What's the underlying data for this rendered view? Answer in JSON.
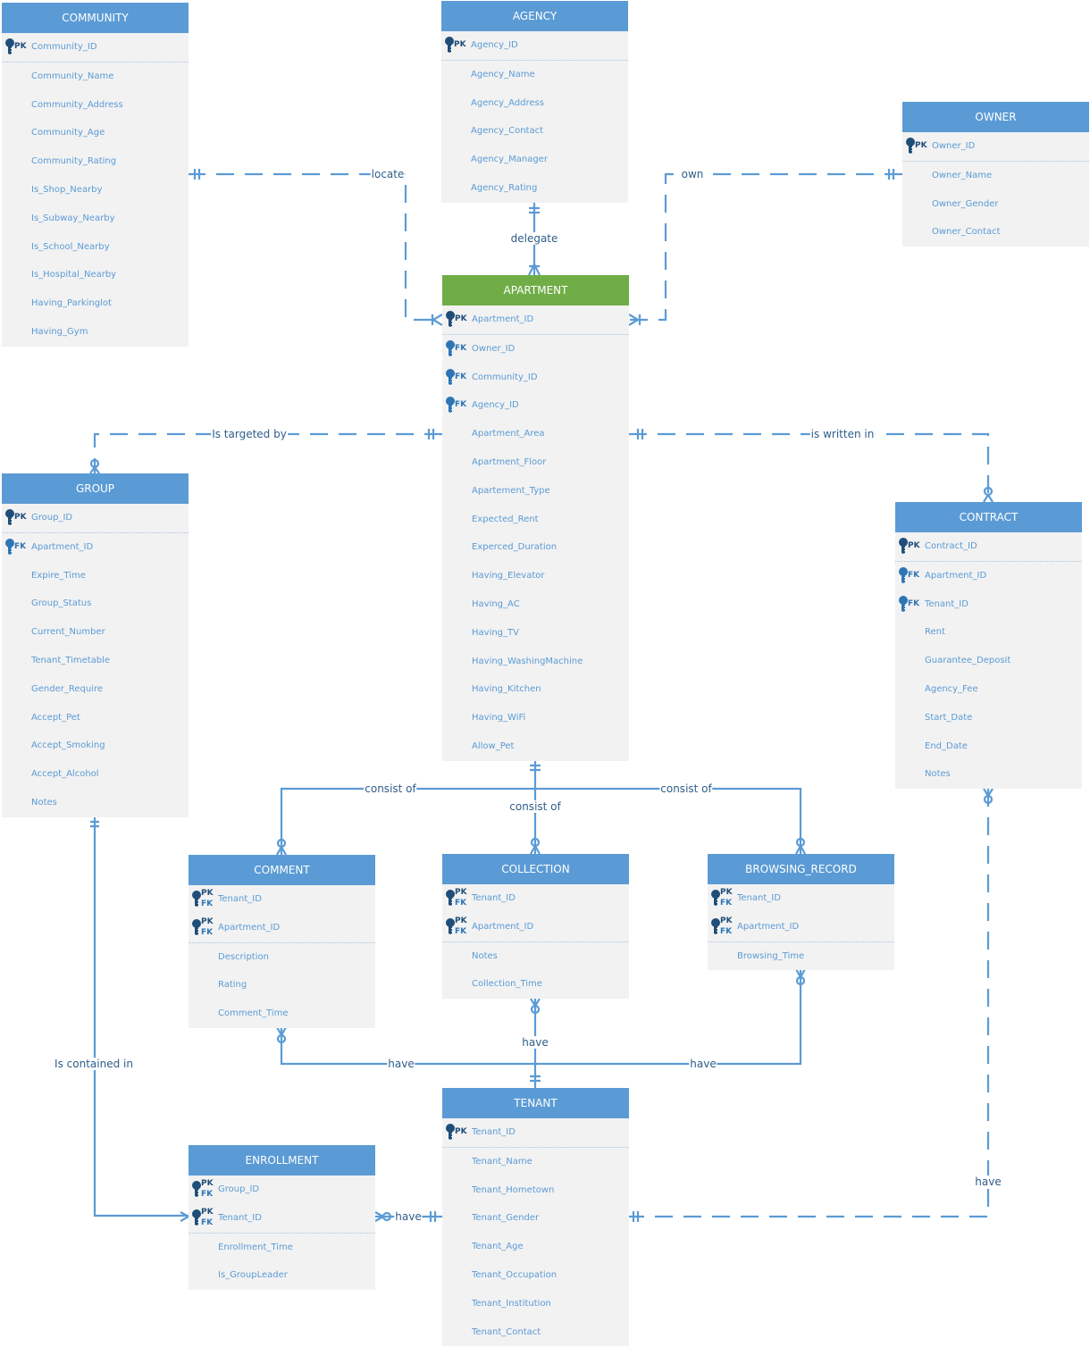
{
  "colors": {
    "header": "#5b9bd5",
    "header_main": "#70ad47",
    "line": "#5b9bd5",
    "key_pk": "#1f4e79",
    "key_fk": "#2e75b6"
  },
  "entities": [
    {
      "id": "community",
      "title": "COMMUNITY",
      "sep": 1,
      "rows": [
        [
          "PK",
          "Community_ID"
        ],
        [
          "",
          "Community_Name"
        ],
        [
          "",
          "Community_Address"
        ],
        [
          "",
          "Community_Age"
        ],
        [
          "",
          "Community_Rating"
        ],
        [
          "",
          "Is_Shop_Nearby"
        ],
        [
          "",
          "Is_Subway_Nearby"
        ],
        [
          "",
          "Is_School_Nearby"
        ],
        [
          "",
          "Is_Hospital_Nearby"
        ],
        [
          "",
          "Having_Parkinglot"
        ],
        [
          "",
          "Having_Gym"
        ]
      ]
    },
    {
      "id": "agency",
      "title": "AGENCY",
      "sep": 1,
      "rows": [
        [
          "PK",
          "Agency_ID"
        ],
        [
          "",
          "Agency_Name"
        ],
        [
          "",
          "Agency_Address"
        ],
        [
          "",
          "Agency_Contact"
        ],
        [
          "",
          "Agency_Manager"
        ],
        [
          "",
          "Agency_Rating"
        ]
      ]
    },
    {
      "id": "owner",
      "title": "OWNER",
      "sep": 1,
      "rows": [
        [
          "PK",
          "Owner_ID"
        ],
        [
          "",
          "Owner_Name"
        ],
        [
          "",
          "Owner_Gender"
        ],
        [
          "",
          "Owner_Contact"
        ]
      ]
    },
    {
      "id": "apartment",
      "title": "APARTMENT",
      "main": true,
      "sep": 1,
      "rows": [
        [
          "PK",
          "Apartment_ID"
        ],
        [
          "FK",
          "Owner_ID"
        ],
        [
          "FK",
          "Community_ID"
        ],
        [
          "FK",
          "Agency_ID"
        ],
        [
          "",
          "Apartment_Area"
        ],
        [
          "",
          "Apartment_Floor"
        ],
        [
          "",
          "Apartement_Type"
        ],
        [
          "",
          "Expected_Rent"
        ],
        [
          "",
          "Experced_Duration"
        ],
        [
          "",
          "Having_Elevator"
        ],
        [
          "",
          "Having_AC"
        ],
        [
          "",
          "Having_TV"
        ],
        [
          "",
          "Having_WashingMachine"
        ],
        [
          "",
          "Having_Kitchen"
        ],
        [
          "",
          "Having_WiFi"
        ],
        [
          "",
          "Allow_Pet"
        ]
      ]
    },
    {
      "id": "group",
      "title": "GROUP",
      "sep": 1,
      "rows": [
        [
          "PK",
          "Group_ID"
        ],
        [
          "FK",
          "Apartment_ID"
        ],
        [
          "",
          "Expire_Time"
        ],
        [
          "",
          "Group_Status"
        ],
        [
          "",
          "Current_Number"
        ],
        [
          "",
          "Tenant_Timetable"
        ],
        [
          "",
          "Gender_Require"
        ],
        [
          "",
          "Accept_Pet"
        ],
        [
          "",
          "Accept_Smoking"
        ],
        [
          "",
          "Accept_Alcohol"
        ],
        [
          "",
          "Notes"
        ]
      ]
    },
    {
      "id": "contract",
      "title": "CONTRACT",
      "sep": 1,
      "rows": [
        [
          "PK",
          "Contract_ID"
        ],
        [
          "FK",
          "Apartment_ID"
        ],
        [
          "FK",
          "Tenant_ID"
        ],
        [
          "",
          "Rent"
        ],
        [
          "",
          "Guarantee_Deposit"
        ],
        [
          "",
          "Agency_Fee"
        ],
        [
          "",
          "Start_Date"
        ],
        [
          "",
          "End_Date"
        ],
        [
          "",
          "Notes"
        ]
      ]
    },
    {
      "id": "comment",
      "title": "COMMENT",
      "sep": 2,
      "rows": [
        [
          "PKFK",
          "Tenant_ID"
        ],
        [
          "PKFK",
          "Apartment_ID"
        ],
        [
          "",
          "Description"
        ],
        [
          "",
          "Rating"
        ],
        [
          "",
          "Comment_Time"
        ]
      ]
    },
    {
      "id": "collection",
      "title": "COLLECTION",
      "sep": 2,
      "rows": [
        [
          "PKFK",
          "Tenant_ID"
        ],
        [
          "PKFK",
          "Apartment_ID"
        ],
        [
          "",
          "Notes"
        ],
        [
          "",
          "Collection_Time"
        ]
      ]
    },
    {
      "id": "browsing-record",
      "title": "BROWSING_RECORD",
      "sep": 2,
      "rows": [
        [
          "PKFK",
          "Tenant_ID"
        ],
        [
          "PKFK",
          "Apartment_ID"
        ],
        [
          "",
          "Browsing_Time"
        ]
      ]
    },
    {
      "id": "tenant",
      "title": "TENANT",
      "sep": 1,
      "rows": [
        [
          "PK",
          "Tenant_ID"
        ],
        [
          "",
          "Tenant_Name"
        ],
        [
          "",
          "Tenant_Hometown"
        ],
        [
          "",
          "Tenant_Gender"
        ],
        [
          "",
          "Tenant_Age"
        ],
        [
          "",
          "Tenant_Occupation"
        ],
        [
          "",
          "Tenant_Institution"
        ],
        [
          "",
          "Tenant_Contact"
        ]
      ]
    },
    {
      "id": "enrollment",
      "title": "ENROLLMENT",
      "sep": 2,
      "rows": [
        [
          "PKFK",
          "Group_ID"
        ],
        [
          "PKFK",
          "Tenant_ID"
        ],
        [
          "",
          "Enrollment_Time"
        ],
        [
          "",
          "Is_GroupLeader"
        ]
      ]
    }
  ],
  "relations": [
    "locate",
    "delegate",
    "own",
    "Is targeted by",
    "is written in",
    "consist of",
    "consist of",
    "consist of",
    "have",
    "have",
    "have",
    "Is contained in",
    "have",
    "have"
  ]
}
